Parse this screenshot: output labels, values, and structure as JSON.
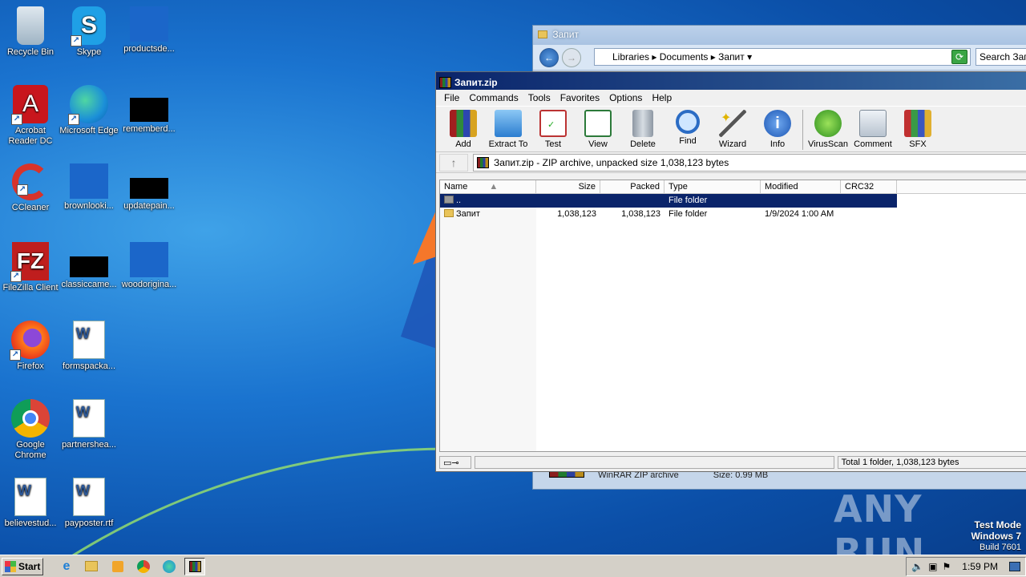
{
  "desktop": {
    "icons": [
      {
        "label": "Recycle Bin"
      },
      {
        "label": "Skype"
      },
      {
        "label": "productsde..."
      },
      {
        "label": "Acrobat Reader DC"
      },
      {
        "label": "Microsoft Edge"
      },
      {
        "label": "rememberd..."
      },
      {
        "label": "CCleaner"
      },
      {
        "label": "brownlooki..."
      },
      {
        "label": "updatepain..."
      },
      {
        "label": "FileZilla Client"
      },
      {
        "label": "classiccame..."
      },
      {
        "label": "woodorigina..."
      },
      {
        "label": "Firefox"
      },
      {
        "label": "formspacka..."
      },
      {
        "label": "Google Chrome"
      },
      {
        "label": "partnershea..."
      },
      {
        "label": "believestud..."
      },
      {
        "label": "payposter.rtf"
      }
    ]
  },
  "explorer": {
    "title": "Запит",
    "breadcrumb": [
      "Libraries",
      "Documents",
      "Запит"
    ],
    "search_placeholder": "Search Запит",
    "peek_text": "WinRAR ZIP archive",
    "peek_size": "Size: 0.99 MB"
  },
  "winrar": {
    "title": "Запит.zip",
    "menu": [
      "File",
      "Commands",
      "Tools",
      "Favorites",
      "Options",
      "Help"
    ],
    "toolbar": [
      "Add",
      "Extract To",
      "Test",
      "View",
      "Delete",
      "Find",
      "Wizard",
      "Info",
      "VirusScan",
      "Comment",
      "SFX"
    ],
    "path_text": "Запит.zip - ZIP archive, unpacked size 1,038,123 bytes",
    "columns": [
      "Name",
      "Size",
      "Packed",
      "Type",
      "Modified",
      "CRC32"
    ],
    "rows": [
      {
        "name": "..",
        "size": "",
        "packed": "",
        "type": "File folder",
        "modified": "",
        "crc": ""
      },
      {
        "name": "Запит",
        "size": "1,038,123",
        "packed": "1,038,123",
        "type": "File folder",
        "modified": "1/9/2024 1:00 AM",
        "crc": ""
      }
    ],
    "status_total": "Total 1 folder, 1,038,123 bytes"
  },
  "taskbar": {
    "start_label": "Start",
    "clock": "1:59 PM"
  },
  "watermark": {
    "line1": "Test Mode",
    "line2": "Windows 7",
    "line3": "Build 7601",
    "brand": "ANY RUN"
  }
}
